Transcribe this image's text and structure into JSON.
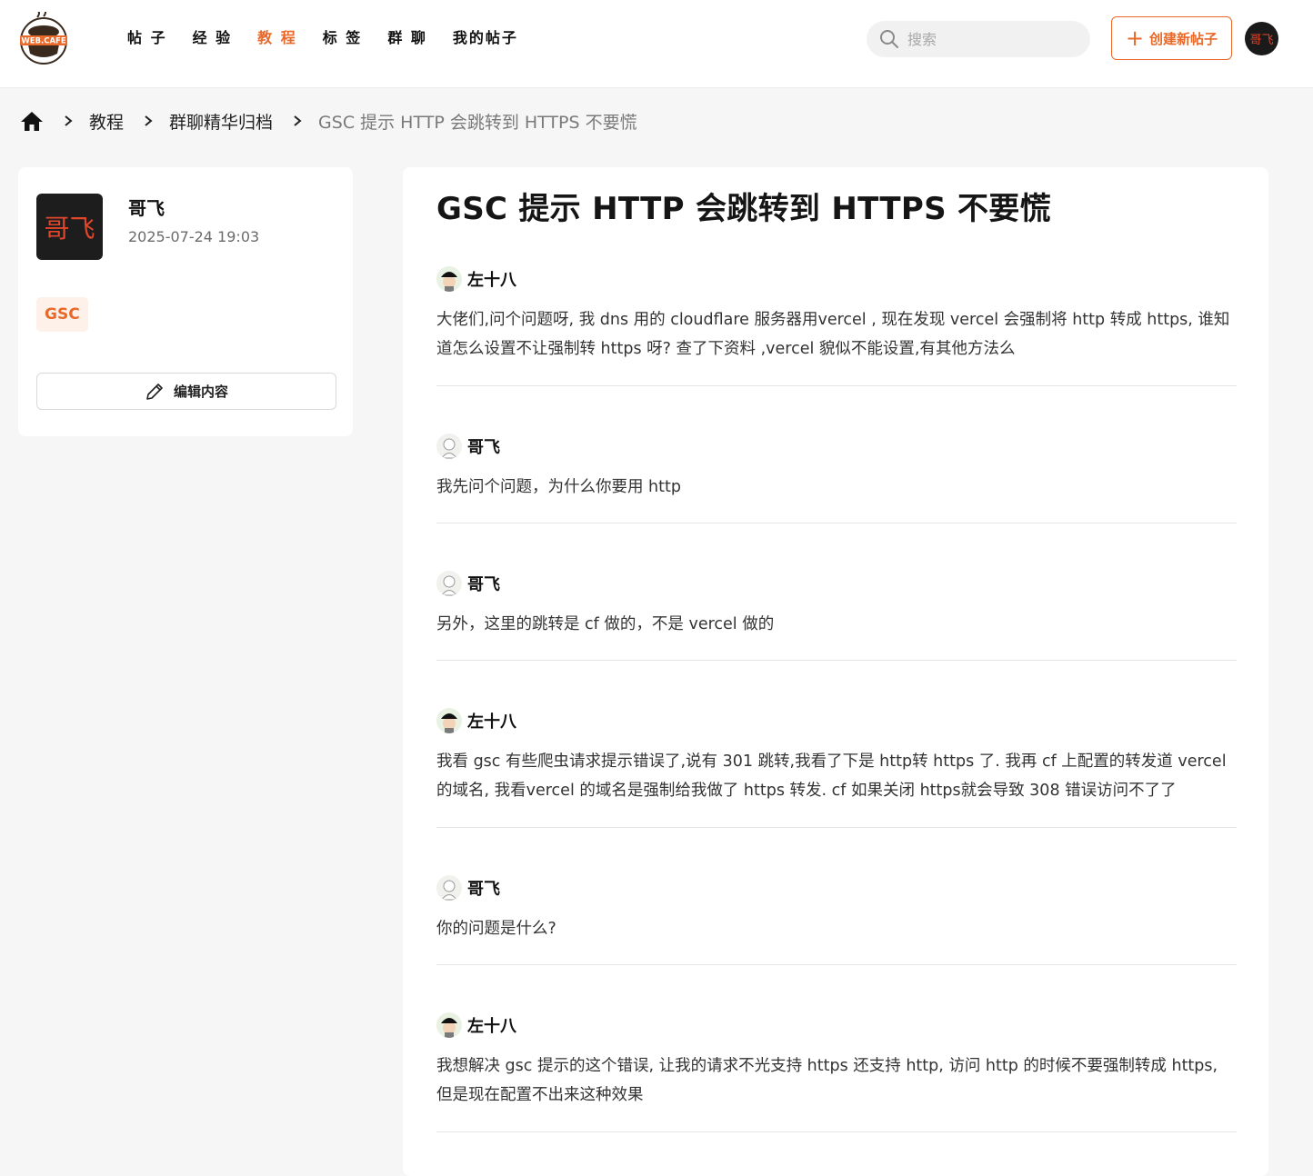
{
  "header": {
    "logo_text": "WEB.CAFE",
    "nav": [
      {
        "label": "帖 子",
        "active": false
      },
      {
        "label": "经 验",
        "active": false
      },
      {
        "label": "教 程",
        "active": true
      },
      {
        "label": "标 签",
        "active": false
      },
      {
        "label": "群 聊",
        "active": false
      },
      {
        "label": "我的帖子",
        "active": false
      }
    ],
    "search_placeholder": "搜索",
    "create_label": "创建新帖子",
    "user_avatar_text": "哥飞",
    "accent_color": "#e8692a"
  },
  "breadcrumb": {
    "items": [
      "教程",
      "群聊精华归档"
    ],
    "current": "GSC 提示 HTTP 会跳转到 HTTPS 不要慌"
  },
  "sidebar": {
    "author_avatar_text": "哥飞",
    "author_name": "哥飞",
    "date": "2025-07-24 19:03",
    "tag": "GSC",
    "edit_label": "编辑内容"
  },
  "post": {
    "title": "GSC 提示 HTTP 会跳转到 HTTPS 不要慌",
    "messages": [
      {
        "author": "左十八",
        "avatar": "zuo",
        "text": "大佬们,问个问题呀, 我 dns 用的 cloudflare 服务器用vercel , 现在发现 vercel 会强制将 http 转成 https, 谁知道怎么设置不让强制转 https 呀? 查了下资料 ,vercel 貌似不能设置,有其他方法么"
      },
      {
        "author": "哥飞",
        "avatar": "ge",
        "text": "我先问个问题，为什么你要用 http"
      },
      {
        "author": "哥飞",
        "avatar": "ge",
        "text": "另外，这里的跳转是 cf 做的，不是 vercel 做的"
      },
      {
        "author": "左十八",
        "avatar": "zuo",
        "text": "我看 gsc 有些爬虫请求提示错误了,说有 301 跳转,我看了下是 http转 https 了. 我再 cf 上配置的转发道 vercel 的域名, 我看vercel 的域名是强制给我做了 https 转发. cf 如果关闭 https就会导致 308 错误访问不了了"
      },
      {
        "author": "哥飞",
        "avatar": "ge",
        "text": "你的问题是什么?"
      },
      {
        "author": "左十八",
        "avatar": "zuo",
        "text": "我想解决 gsc 提示的这个错误, 让我的请求不光支持 https 还支持 http, 访问 http 的时候不要强制转成 https, 但是现在配置不出来这种效果"
      }
    ]
  }
}
